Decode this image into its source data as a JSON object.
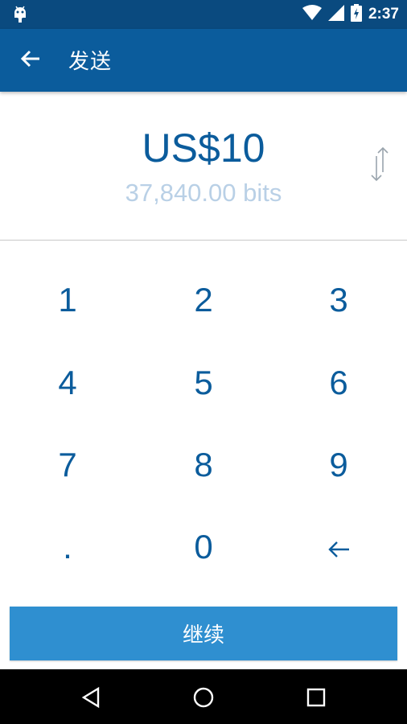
{
  "status_bar": {
    "time": "2:37",
    "icons": [
      "android-debug-icon",
      "wifi-icon",
      "signal-icon",
      "battery-charging-icon"
    ]
  },
  "app_bar": {
    "title": "发送",
    "back_icon": "arrow-left-icon"
  },
  "amount": {
    "primary": "US$10",
    "secondary": "37,840.00 bits",
    "swap_icon": "swap-vertical-icon"
  },
  "keypad": {
    "keys": [
      "1",
      "2",
      "3",
      "4",
      "5",
      "6",
      "7",
      "8",
      "9",
      ".",
      "0"
    ],
    "backspace_icon": "backspace-arrow-icon"
  },
  "continue_label": "继续",
  "nav_bar": [
    "back-triangle-icon",
    "home-circle-icon",
    "recents-square-icon"
  ],
  "colors": {
    "status_bar": "#0a4a7f",
    "app_bar": "#0b5c9c",
    "amount_text": "#0b5c9c",
    "amount_sub_text": "#b9d0e6",
    "button": "#2f8fd0"
  }
}
